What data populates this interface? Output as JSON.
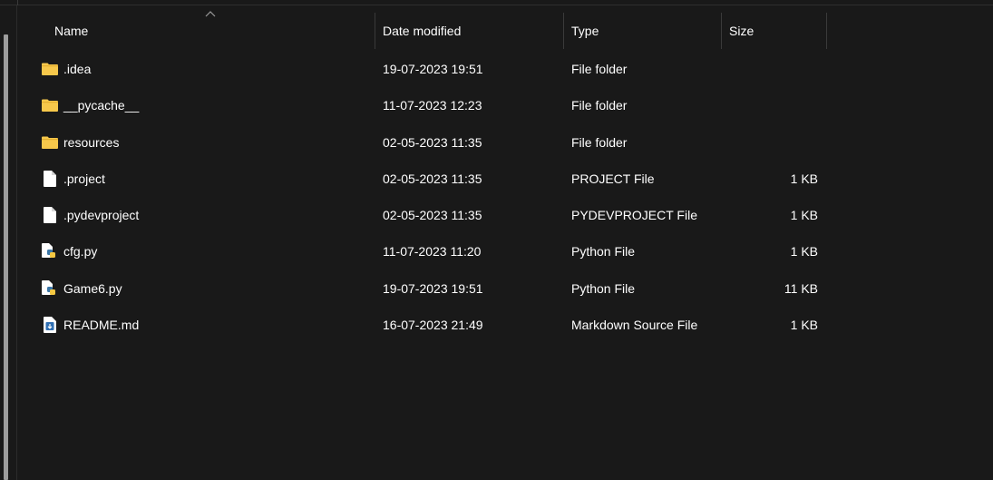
{
  "columns": {
    "name": "Name",
    "date": "Date modified",
    "type": "Type",
    "size": "Size"
  },
  "files": [
    {
      "name": ".idea",
      "date": "19-07-2023 19:51",
      "type": "File folder",
      "size": "",
      "icon": "folder-icon"
    },
    {
      "name": "__pycache__",
      "date": "11-07-2023 12:23",
      "type": "File folder",
      "size": "",
      "icon": "folder-icon"
    },
    {
      "name": "resources",
      "date": "02-05-2023 11:35",
      "type": "File folder",
      "size": "",
      "icon": "folder-icon"
    },
    {
      "name": ".project",
      "date": "02-05-2023 11:35",
      "type": "PROJECT File",
      "size": "1 KB",
      "icon": "file-icon"
    },
    {
      "name": ".pydevproject",
      "date": "02-05-2023 11:35",
      "type": "PYDEVPROJECT File",
      "size": "1 KB",
      "icon": "file-icon"
    },
    {
      "name": "cfg.py",
      "date": "11-07-2023 11:20",
      "type": "Python File",
      "size": "1 KB",
      "icon": "python-file-icon"
    },
    {
      "name": "Game6.py",
      "date": "19-07-2023 19:51",
      "type": "Python File",
      "size": "11 KB",
      "icon": "python-file-icon"
    },
    {
      "name": "README.md",
      "date": "16-07-2023 21:49",
      "type": "Markdown Source File",
      "size": "1 KB",
      "icon": "markdown-file-icon"
    }
  ],
  "colors": {
    "background": "#191919",
    "text": "#ffffff",
    "folder": "#f7c84b",
    "separator": "#3a3a3a"
  }
}
